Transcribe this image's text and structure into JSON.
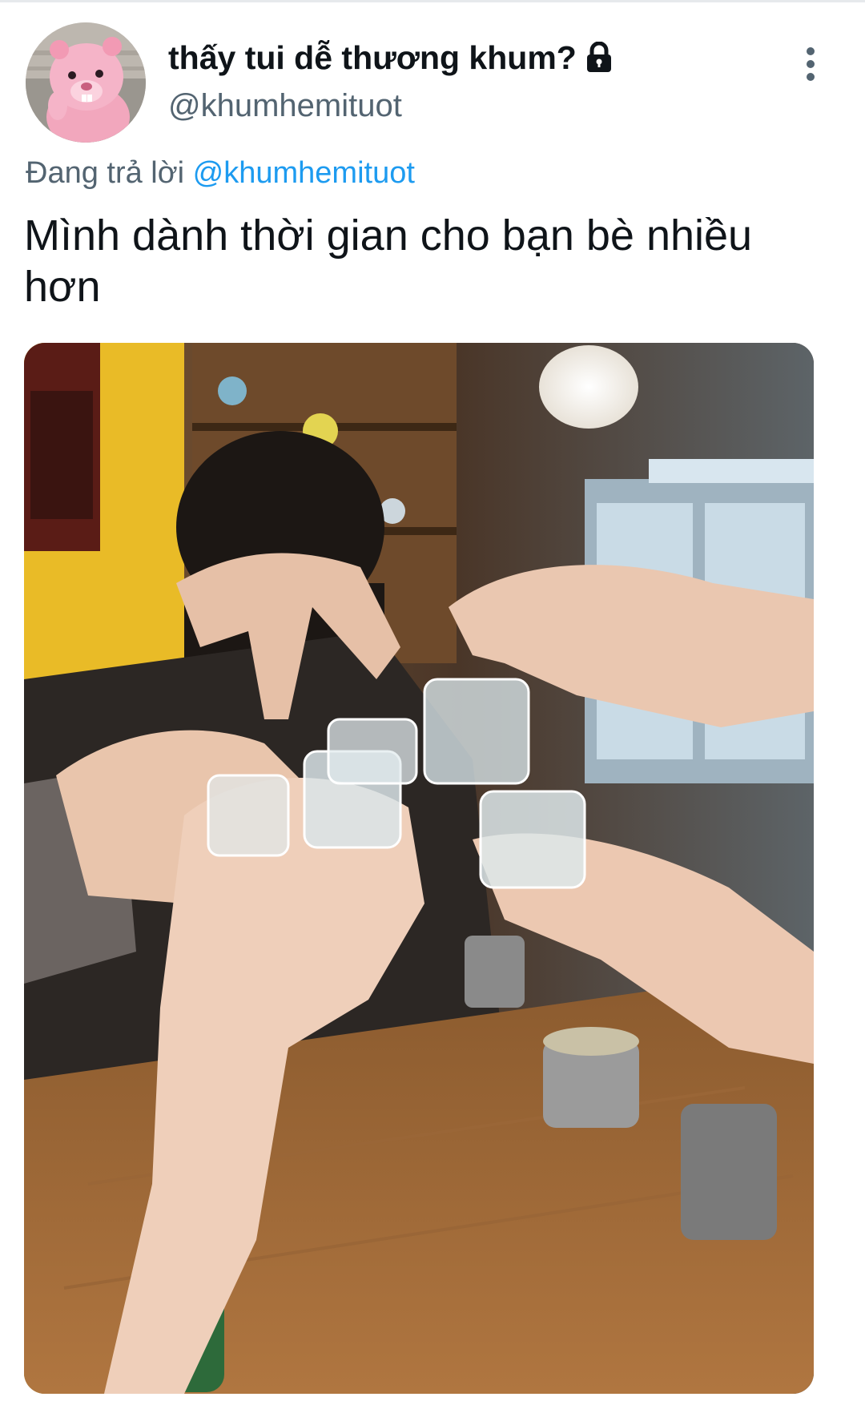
{
  "tweet": {
    "author": {
      "display_name": "thấy tui dễ thương khum?",
      "handle": "@khumhemituot",
      "avatar_icon": "pink-beaver-avatar",
      "protected_icon": "lock-icon"
    },
    "more_icon": "more-vertical-icon",
    "reply_context": {
      "prefix": "Đang trả lời",
      "mention": "@khumhemituot"
    },
    "text": "Mình dành thời gian cho bạn bè nhiều hơn",
    "media": {
      "kind": "photo"
    }
  },
  "colors": {
    "text_primary": "#0f1419",
    "text_secondary": "#536471",
    "link": "#1d9bf0",
    "background": "#ffffff"
  }
}
